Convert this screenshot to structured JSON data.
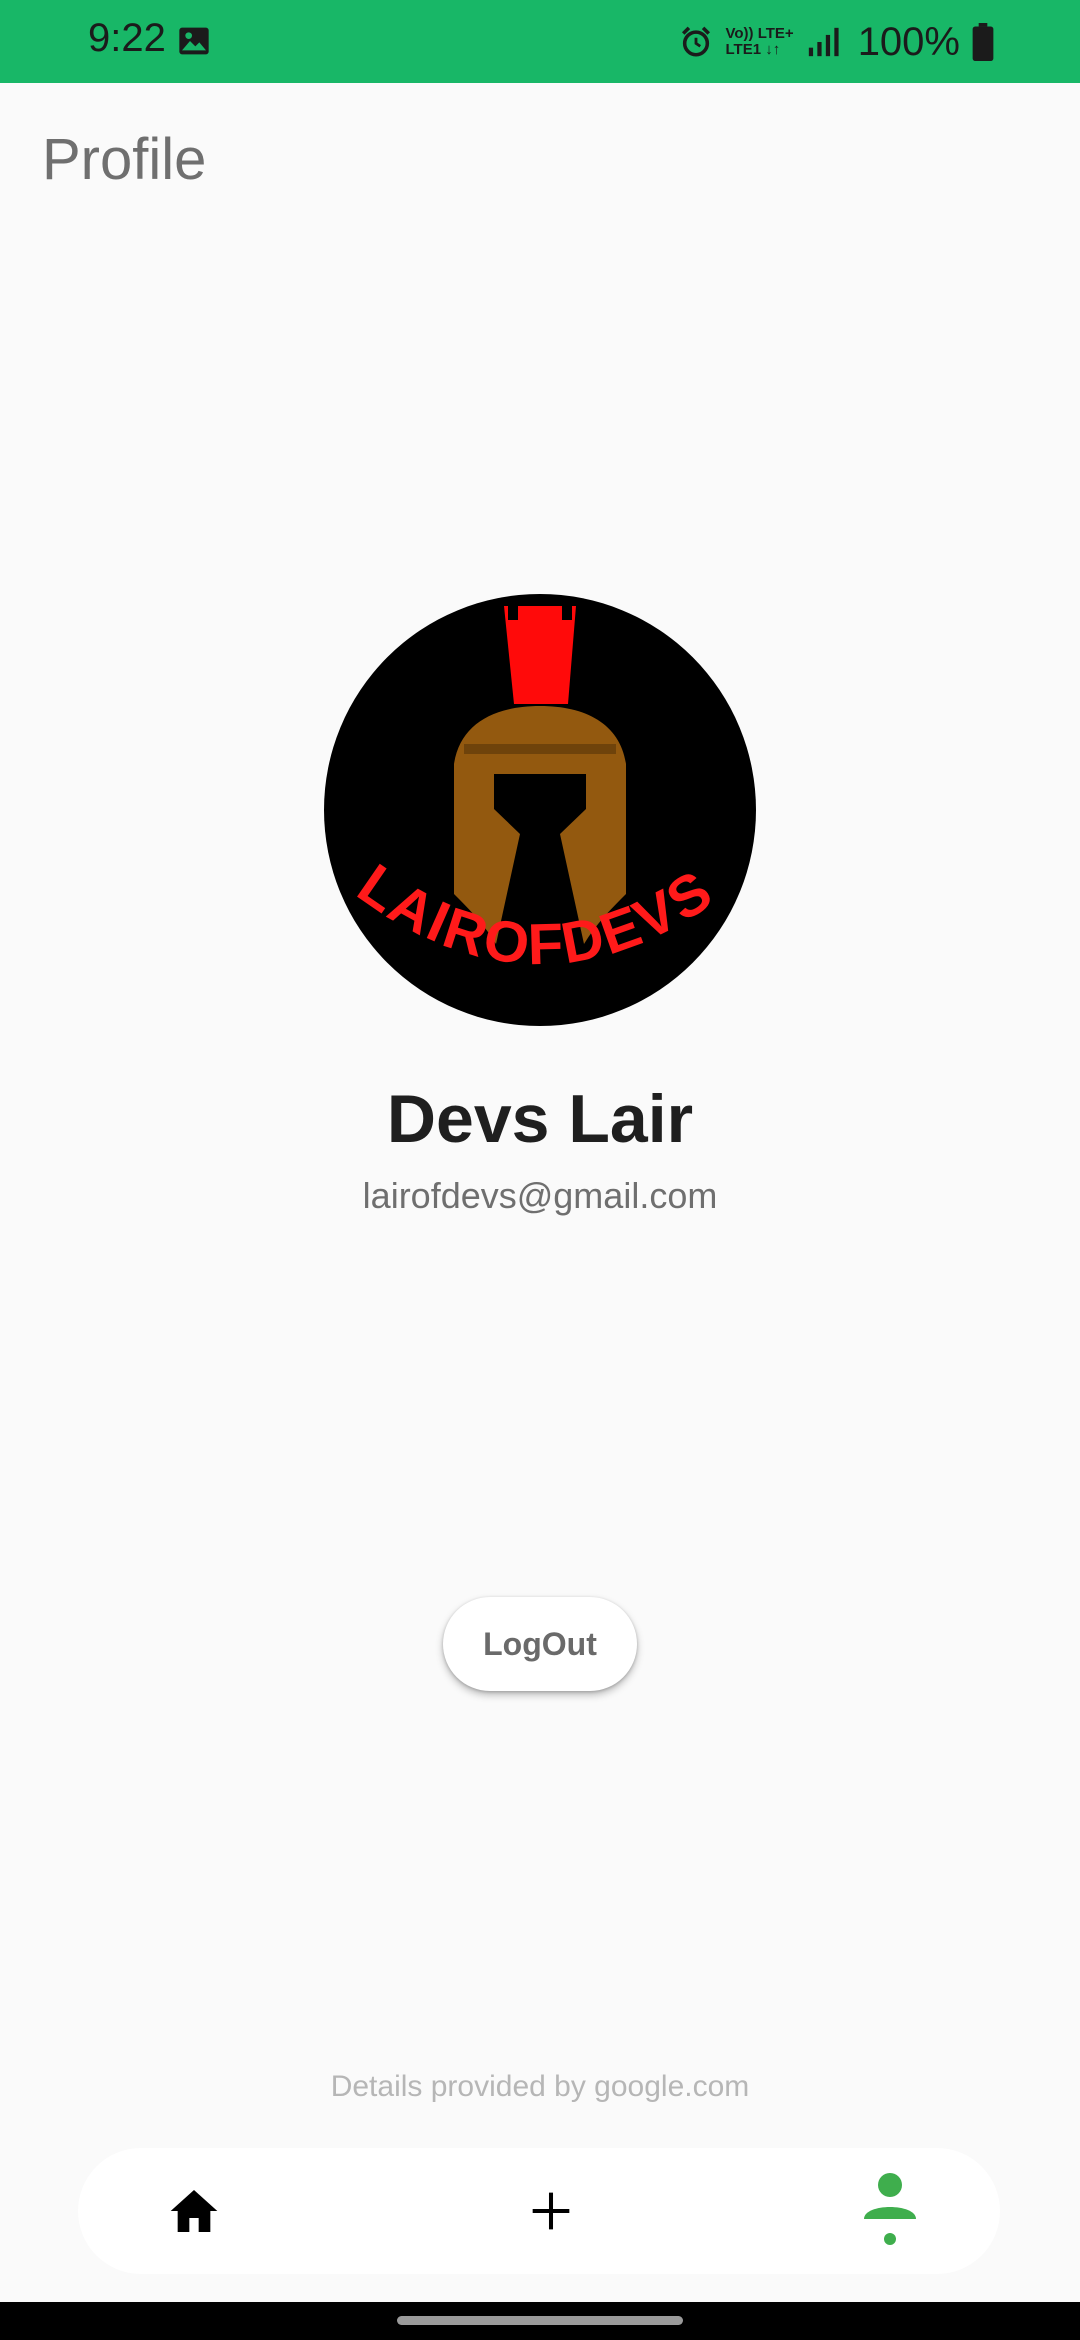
{
  "status_bar": {
    "time": "9:22",
    "network_line1": "Vo)) LTE+",
    "network_line2": "LTE1 ↓↑",
    "battery_text": "100%",
    "background": "#18b767"
  },
  "header": {
    "title": "Profile"
  },
  "profile": {
    "avatar_logo_text": "LAIROFDEVS",
    "name": "Devs Lair",
    "email": "lairofdevs@gmail.com"
  },
  "actions": {
    "logout_label": "LogOut"
  },
  "footer": {
    "note": "Details provided by google.com"
  },
  "bottom_nav": {
    "items": [
      {
        "icon": "home-icon",
        "active": false
      },
      {
        "icon": "plus-icon",
        "active": false
      },
      {
        "icon": "person-icon",
        "active": true
      }
    ],
    "active_color": "#3fae4d"
  }
}
